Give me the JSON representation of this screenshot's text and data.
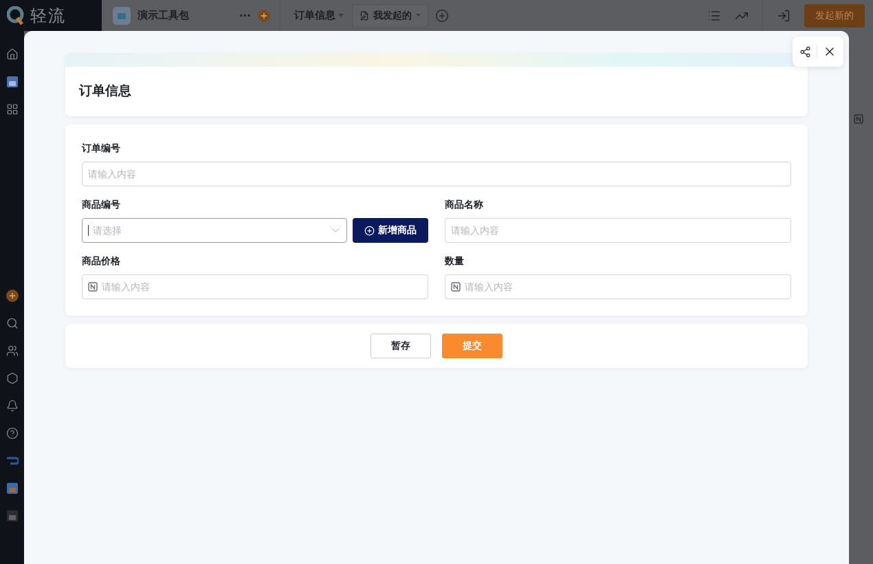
{
  "app": {
    "logo": "轻流",
    "workspace": "演示工具包",
    "more": "···",
    "nav_title": "订单信息",
    "view_tab": "我发起的",
    "primary_action": "发起新的"
  },
  "modal": {
    "title": "订单信息",
    "rows": [
      {
        "fields": [
          {
            "label": "订单编号",
            "kind": "text",
            "placeholder": "请输入内容"
          }
        ]
      },
      {
        "fields": [
          {
            "label": "商品编号",
            "kind": "select",
            "placeholder": "请选择",
            "focused": true,
            "add_button": "新增商品"
          },
          {
            "label": "商品名称",
            "kind": "text",
            "placeholder": "请输入内容"
          }
        ]
      },
      {
        "fields": [
          {
            "label": "商品价格",
            "kind": "number",
            "placeholder": "请输入内容"
          },
          {
            "label": "数量",
            "kind": "number",
            "placeholder": "请输入内容"
          }
        ]
      }
    ],
    "buttons": [
      {
        "label": "暂存",
        "kind": "secondary"
      },
      {
        "label": "提交",
        "kind": "primary"
      }
    ]
  }
}
